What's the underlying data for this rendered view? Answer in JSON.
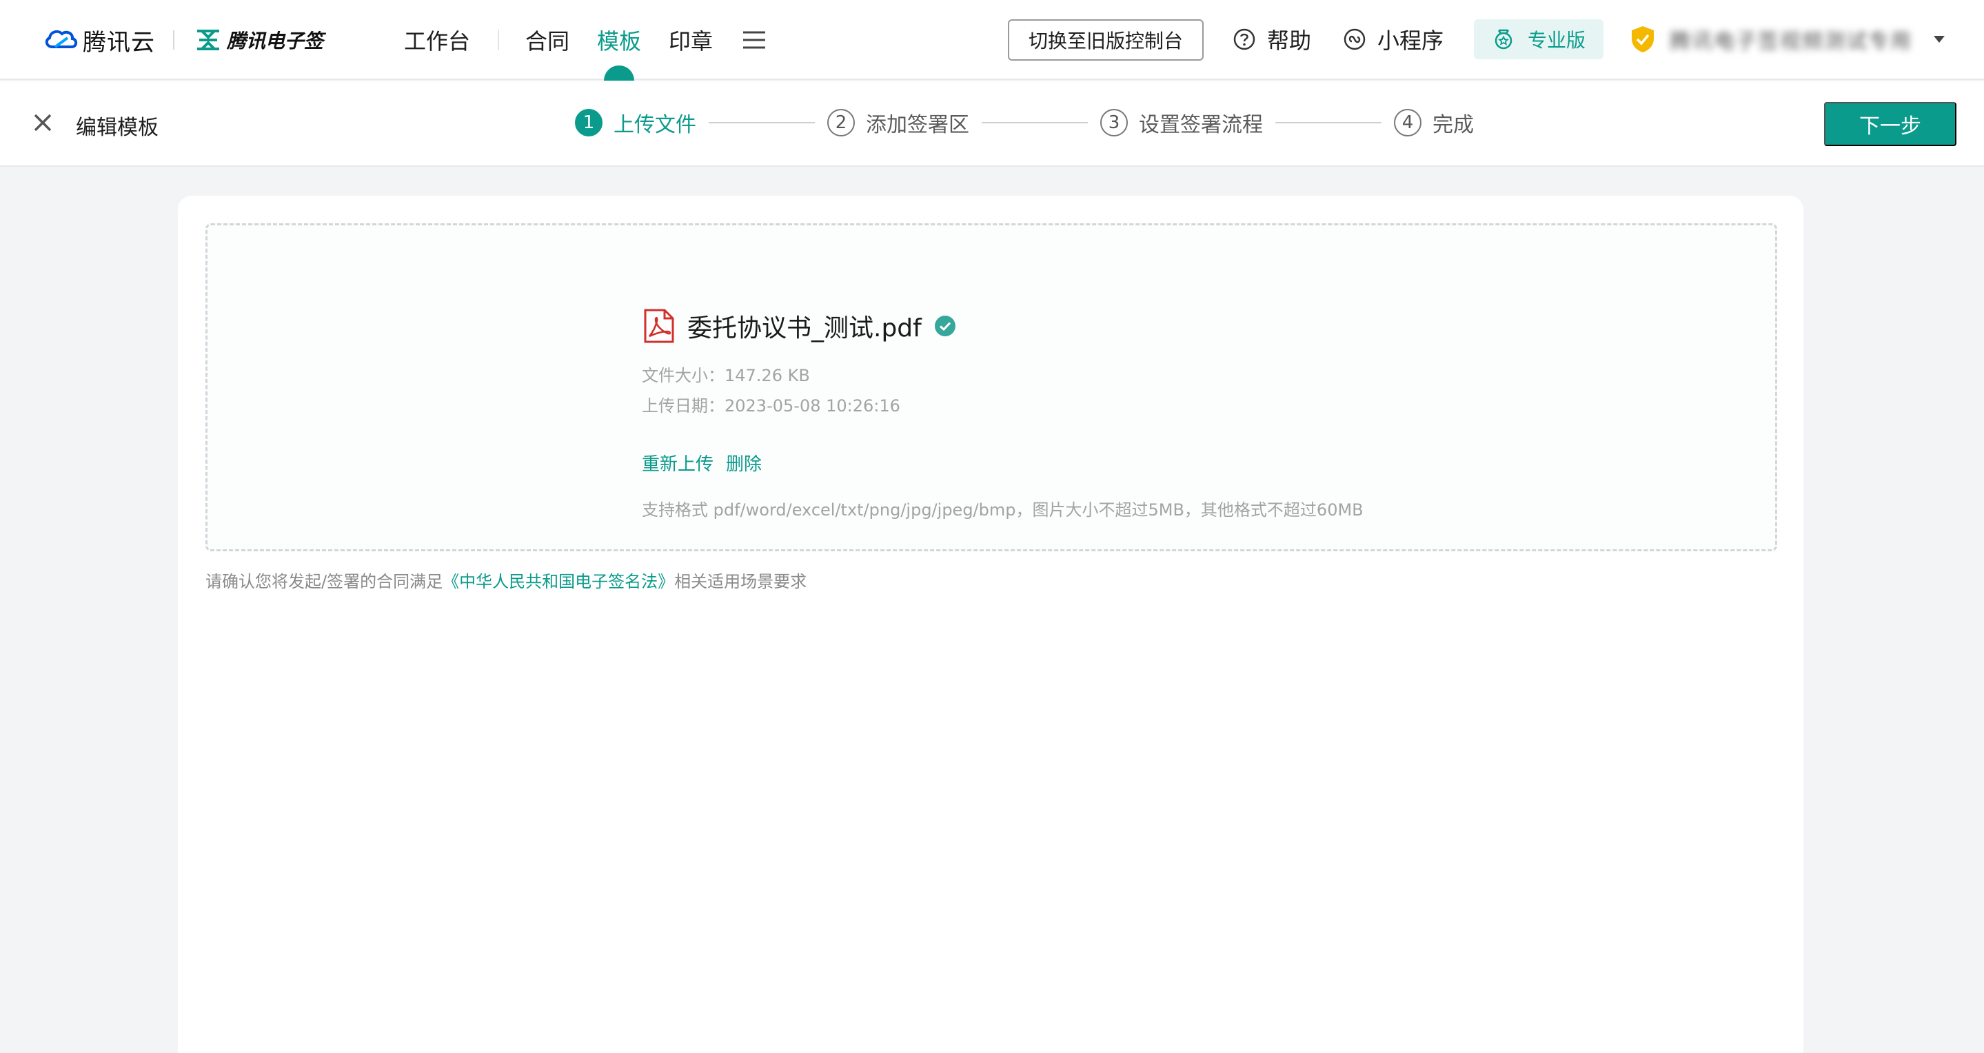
{
  "brand": {
    "cloud_name": "腾讯云",
    "product_name": "腾讯电子签"
  },
  "nav": {
    "workbench": "工作台",
    "contract": "合同",
    "template": "模板",
    "seal": "印章",
    "menu_icon": "hamburger-menu-icon"
  },
  "header_right": {
    "switch_label": "切换至旧版控制台",
    "help_label": "帮助",
    "miniprogram_label": "小程序",
    "pro_label": "专业版",
    "account_name": "腾讯电子签视频测试专用"
  },
  "stepbar": {
    "title": "编辑模板",
    "steps": [
      {
        "num": "1",
        "label": "上传文件"
      },
      {
        "num": "2",
        "label": "添加签署区"
      },
      {
        "num": "3",
        "label": "设置签署流程"
      },
      {
        "num": "4",
        "label": "完成"
      }
    ],
    "next_label": "下一步"
  },
  "upload": {
    "file_name": "委托协议书_测试.pdf",
    "size_label": "文件大小：",
    "size_value": "147.26 KB",
    "date_label": "上传日期：",
    "date_value": "2023-05-08 10:26:16",
    "reupload_label": "重新上传",
    "delete_label": "删除",
    "formats_text": "支持格式 pdf/word/excel/txt/png/jpg/jpeg/bmp，图片大小不超过5MB，其他格式不超过60MB"
  },
  "notice": {
    "prefix": "请确认您将发起/签署的合同满足",
    "law": "《中华人民共和国电子签名法》",
    "suffix": "相关适用场景要求"
  },
  "colors": {
    "accent": "#0a9b8c",
    "pdf_red": "#d0312d",
    "shield_yellow": "#f5b800"
  }
}
